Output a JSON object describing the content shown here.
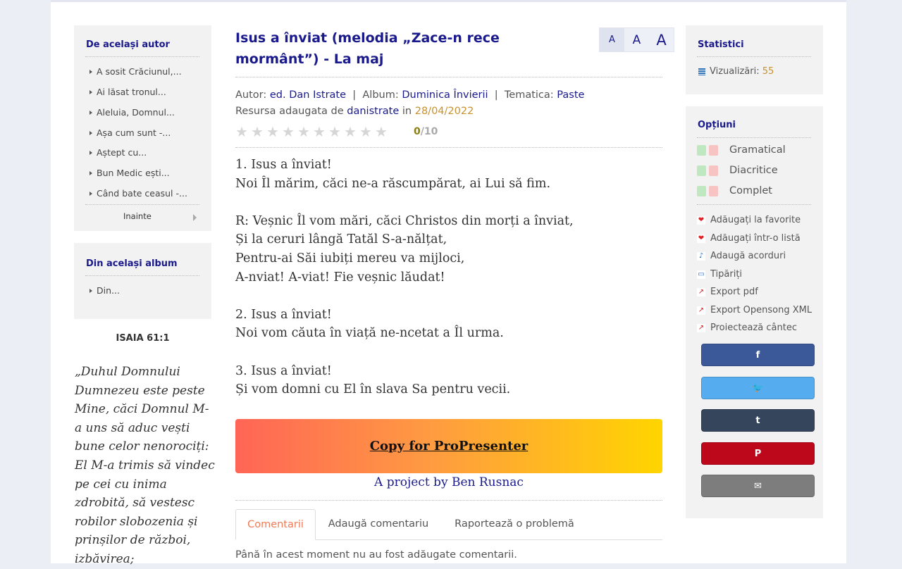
{
  "left": {
    "author_box": {
      "title": "De același autor",
      "items": [
        {
          "label": "A sosit Crăciunul,..."
        },
        {
          "label": "Ai lăsat tronul..."
        },
        {
          "label": "Aleluia, Domnul..."
        },
        {
          "label": "Așa cum sunt -..."
        },
        {
          "label": "Aștept cu..."
        },
        {
          "label": "Bun Medic ești..."
        },
        {
          "label": "Când bate ceasul -..."
        }
      ],
      "next_label": "Inainte"
    },
    "album_box": {
      "title": "Din același album",
      "items": [
        {
          "label": "Din..."
        }
      ]
    },
    "verse_ref": "ISAIA 61:1",
    "verse_text": "„Duhul Domnului Dumnezeu este peste Mine, căci Domnul M-a uns să aduc vești bune celor nenorociți: El M-a trimis să vindec pe cei cu inima zdrobită, să vestesc robilor slobozenia și prinșilor de război, izbăvirea;"
  },
  "main": {
    "title": "Isus a înviat (melodia „Zace-n rece mormânt”) - La maj",
    "font_sizes": [
      "A",
      "A",
      "A"
    ],
    "author_label": "Autor:",
    "author": "ed. Dan Istrate",
    "album_label": "Album:",
    "album": "Duminica Învierii",
    "theme_label": "Tematica:",
    "theme": "Paste",
    "separator": "|",
    "added_by_label": "Resursa adaugata de",
    "added_by": "danistrate",
    "added_in_label": "in",
    "added_date": "28/04/2022",
    "rating": {
      "current": "0",
      "total": "/10",
      "stars": 10,
      "value": 0
    },
    "lyrics": "1. Isus a înviat!\nNoi Îl mărim, căci ne-a răscumpărat, ai Lui să fim.\n\nR: Veșnic Îl vom mări, căci Christos din morți a înviat,\nȘi la ceruri lângă Tatăl S-a-nălțat,\nPentru-ai Săi iubiți mereu va mijloci,\nA-nviat! A-viat! Fie veșnic lăudat!\n\n2. Isus a înviat!\nNoi vom căuta în viață ne-ncetat a Îl urma.\n\n3. Isus a înviat!\nȘi vom domni cu El în slava Sa pentru vecii.",
    "propresenter_label": "Copy for ProPresenter",
    "project_by": "A project by Ben Rusnac",
    "tabs": [
      {
        "label": "Comentarii",
        "active": true
      },
      {
        "label": "Adaugă comentariu",
        "active": false
      },
      {
        "label": "Raportează o problemă",
        "active": false
      }
    ],
    "no_comments": "Până în acest moment nu au fost adăugate comentarii."
  },
  "right": {
    "stats": {
      "title": "Statistici",
      "views_label": "Vizualizări:",
      "views": "55"
    },
    "options": {
      "title": "Opțiuni",
      "formats": [
        {
          "label": "Gramatical"
        },
        {
          "label": "Diacritice"
        },
        {
          "label": "Complet"
        }
      ],
      "actions": [
        {
          "label": "Adăugați la favorite",
          "icon": "heart-icon"
        },
        {
          "label": "Adăugați într-o listă",
          "icon": "heart-icon"
        },
        {
          "label": "Adaugă acorduri",
          "icon": "chords-icon"
        },
        {
          "label": "Tipăriți",
          "icon": "printer-icon"
        },
        {
          "label": "Export pdf",
          "icon": "arrow-icon"
        },
        {
          "label": "Export Opensong XML",
          "icon": "arrow-icon"
        },
        {
          "label": "Proiectează cântec",
          "icon": "arrow-icon"
        }
      ]
    },
    "share": [
      {
        "icon": "facebook-icon",
        "glyph": "f",
        "color": "#3b5998"
      },
      {
        "icon": "twitter-icon",
        "glyph": "🐦",
        "color": "#55acee"
      },
      {
        "icon": "tumblr-icon",
        "glyph": "t",
        "color": "#35465c"
      },
      {
        "icon": "pinterest-icon",
        "glyph": "P",
        "color": "#bd081c"
      },
      {
        "icon": "email-icon",
        "glyph": "✉",
        "color": "#7d7d7d"
      }
    ]
  },
  "colors": {
    "accent": "#1a1a8c",
    "date": "#c9912b",
    "tab_active": "#f07a55"
  }
}
